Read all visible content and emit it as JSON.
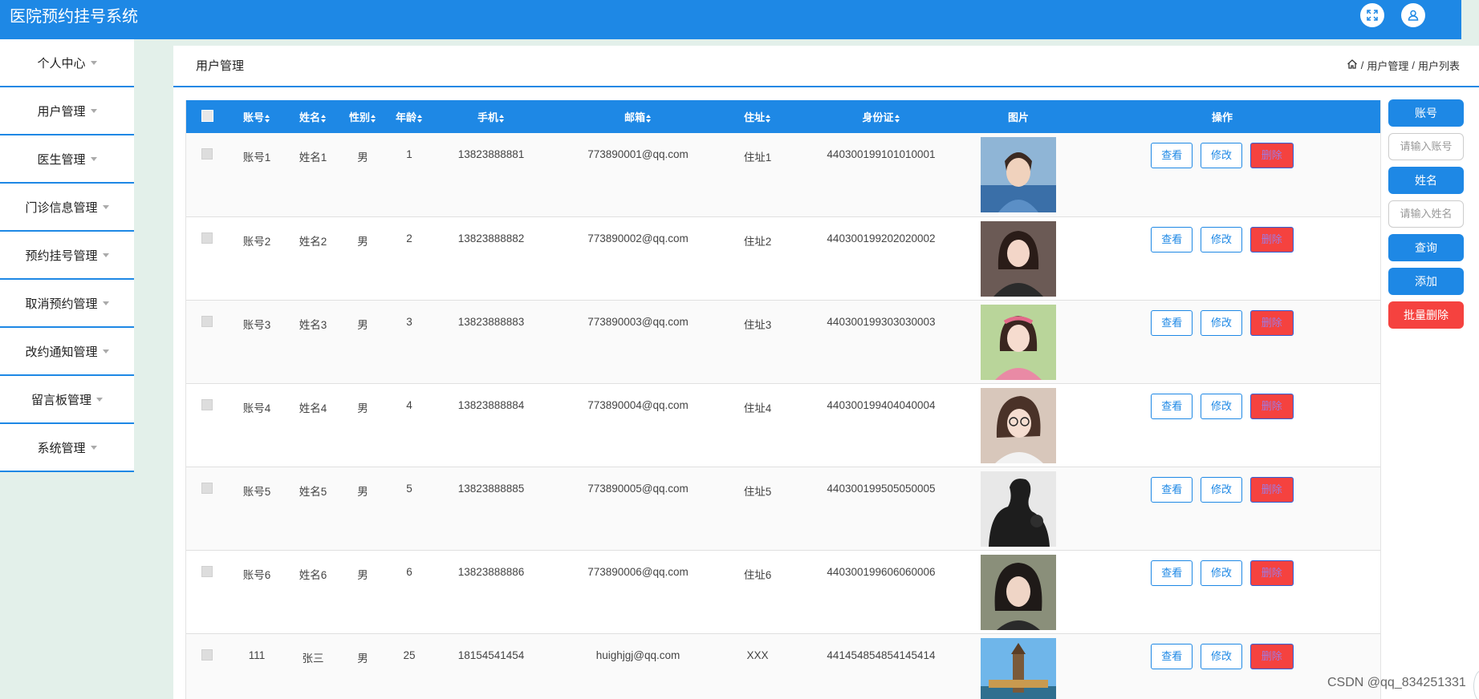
{
  "app": {
    "title": "医院预约挂号系统"
  },
  "header": {
    "icons": [
      "fullscreen-icon",
      "user-icon"
    ]
  },
  "sidebar": {
    "items": [
      {
        "label": "个人中心"
      },
      {
        "label": "用户管理"
      },
      {
        "label": "医生管理"
      },
      {
        "label": "门诊信息管理"
      },
      {
        "label": "预约挂号管理"
      },
      {
        "label": "取消预约管理"
      },
      {
        "label": "改约通知管理"
      },
      {
        "label": "留言板管理"
      },
      {
        "label": "系统管理"
      }
    ]
  },
  "page": {
    "title": "用户管理",
    "breadcrumb": {
      "home_icon": "home-icon",
      "items": [
        "用户管理",
        "用户列表"
      ],
      "separator": "/"
    }
  },
  "table": {
    "headers": {
      "account": "账号",
      "name": "姓名",
      "gender": "性别",
      "age": "年龄",
      "phone": "手机",
      "email": "邮箱",
      "address": "住址",
      "idcard": "身份证",
      "photo": "图片",
      "actions": "操作"
    },
    "action_labels": {
      "view": "查看",
      "edit": "修改",
      "delete": "删除"
    },
    "rows": [
      {
        "account": "账号1",
        "name": "姓名1",
        "gender": "男",
        "age": "1",
        "phone": "13823888881",
        "email": "773890001@qq.com",
        "address": "住址1",
        "idcard": "440300199101010001"
      },
      {
        "account": "账号2",
        "name": "姓名2",
        "gender": "男",
        "age": "2",
        "phone": "13823888882",
        "email": "773890002@qq.com",
        "address": "住址2",
        "idcard": "440300199202020002"
      },
      {
        "account": "账号3",
        "name": "姓名3",
        "gender": "男",
        "age": "3",
        "phone": "13823888883",
        "email": "773890003@qq.com",
        "address": "住址3",
        "idcard": "440300199303030003"
      },
      {
        "account": "账号4",
        "name": "姓名4",
        "gender": "男",
        "age": "4",
        "phone": "13823888884",
        "email": "773890004@qq.com",
        "address": "住址4",
        "idcard": "440300199404040004"
      },
      {
        "account": "账号5",
        "name": "姓名5",
        "gender": "男",
        "age": "5",
        "phone": "13823888885",
        "email": "773890005@qq.com",
        "address": "住址5",
        "idcard": "440300199505050005"
      },
      {
        "account": "账号6",
        "name": "姓名6",
        "gender": "男",
        "age": "6",
        "phone": "13823888886",
        "email": "773890006@qq.com",
        "address": "住址6",
        "idcard": "440300199606060006"
      },
      {
        "account": "111",
        "name": "张三",
        "gender": "男",
        "age": "25",
        "phone": "18154541454",
        "email": "huighjgj@qq.com",
        "address": "XXX",
        "idcard": "441454854854145414"
      }
    ]
  },
  "search": {
    "account_label": "账号",
    "account_placeholder": "请输入账号",
    "name_label": "姓名",
    "name_placeholder": "请输入姓名",
    "query_button": "查询",
    "add_button": "添加",
    "batch_delete_button": "批量删除"
  },
  "watermark": "CSDN @qq_834251331",
  "colors": {
    "primary": "#1e88e5",
    "danger": "#f5423f",
    "background": "#e3f0ea"
  }
}
